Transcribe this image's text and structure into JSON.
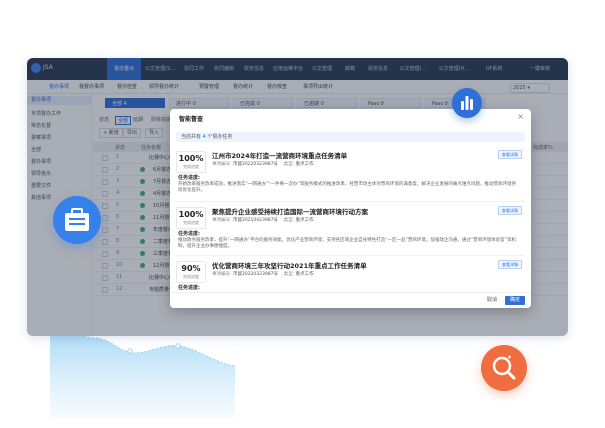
{
  "app": {
    "brand": "JSA"
  },
  "topnav": [
    "督办重点",
    "公文管理(S...",
    "协同工作",
    "协同编辑",
    "政务信息",
    "应用运维平台",
    "公文管理",
    "邮箱",
    "政务信息",
    "公文管理(...",
    "公文管理(H...",
    "OF系统",
    "一键审核"
  ],
  "subtabs": [
    "督办事项",
    "我督办事项",
    "督办检查",
    "领导督办统计",
    "预警管理",
    "督办统计",
    "督办核查",
    "事项导出统计"
  ],
  "year": "2025",
  "sidebar": [
    {
      "label": "督办事项",
      "active": true
    },
    {
      "label": "专项督办工作"
    },
    {
      "label": "常态化督"
    },
    {
      "label": "督察事项"
    },
    {
      "label": "全部"
    },
    {
      "label": "督办事项"
    },
    {
      "label": "领导批示"
    },
    {
      "label": "重要文件"
    },
    {
      "label": "其他事项"
    }
  ],
  "kpis": [
    {
      "label": "全部",
      "value": "4",
      "active": true
    },
    {
      "label": "进行中",
      "value": "0"
    },
    {
      "label": "已完成",
      "value": "0"
    },
    {
      "label": "已逾期",
      "value": "0"
    },
    {
      "label": "Pass",
      "value": "0"
    },
    {
      "label": "Pass",
      "value": "0"
    }
  ],
  "filters": [
    "状态",
    "全部",
    "延期",
    "即将逾期"
  ],
  "buttons": [
    "+ 新增",
    "导出",
    "导入"
  ],
  "table_headers": [
    "状态",
    "任务名称",
    "完成率%"
  ],
  "rows": [
    {
      "n": "1",
      "label": "比赛中心区合并"
    },
    {
      "n": "2",
      "label": "6月督办: 区"
    },
    {
      "n": "3",
      "label": "7月督办: 区"
    },
    {
      "n": "4",
      "label": "4月督办: 区"
    },
    {
      "n": "5",
      "label": "10月督办: 区"
    },
    {
      "n": "6",
      "label": "11月督办: 区"
    },
    {
      "n": "7",
      "label": "年度督办: 区"
    },
    {
      "n": "8",
      "label": "二季度督办"
    },
    {
      "n": "9",
      "label": "三季度督办"
    },
    {
      "n": "10",
      "label": "12月督办: 区"
    },
    {
      "n": "11",
      "label": "比赛中心区合并"
    },
    {
      "n": "12",
      "label": "专题质量督办"
    }
  ],
  "modal": {
    "title": "智能督查",
    "info_prefix": "当前共有",
    "info_count": "4",
    "info_suffix": "个督办任务",
    "cancel": "取消",
    "ok": "确定",
    "cards": [
      {
        "pct": "100%",
        "pct_label": "完成进度",
        "title": "江州市2024年打造一流营商环境重点任务清单",
        "meta_no_label": "事项编号:",
        "meta_no": "市督20220323987号",
        "meta_type_label": "类型:",
        "meta_type": "重点工作",
        "tag": "查看详情",
        "sec": "任务进度:",
        "desc": "开始改革服务改革成效，推进落实“一网通办”“一件事一次办”等服务模式的推进改革，经营市场主体对营商环境的满意度，解决企业发展的痛点难点问题，推动营商环境持续优化提升。"
      },
      {
        "pct": "100%",
        "pct_label": "完成进度",
        "title": "聚焦提升企业感受持续打造国际一流营商环境行动方案",
        "meta_no_label": "事项编号:",
        "meta_no": "市督20210423987号",
        "meta_type_label": "类型:",
        "meta_type": "重点工作",
        "tag": "查看详情",
        "sec": "任务进度:",
        "desc": "推动政务服务改革，提升“一网通办”平台的服务效能。优化产业营商环境，支持各区域企业自身特色打造“一区一品”营商环境，加强政企沟通，通过“营商环境体验官”等机制，提升企业办事便捷度。"
      },
      {
        "pct": "90%",
        "pct_label": "完成进度",
        "title": "优化营商环境三年攻坚行动2021年重点工作任务清单",
        "meta_no_label": "事项编号:",
        "meta_no": "市督20220323987号",
        "meta_type_label": "类型:",
        "meta_type": "重点工作",
        "tag": "查看详情",
        "sec": "任务进度:",
        "desc": "全面提升营商环境，推进政务服务体系建设，持续深化营商环境改革。"
      }
    ]
  },
  "icons": {
    "chart": "bar-chart-icon",
    "case": "briefcase-icon",
    "search": "search-icon"
  },
  "colors": {
    "primary": "#2f6fd8",
    "nav": "#2b3a55",
    "accent_orange": "#f06d3f"
  }
}
